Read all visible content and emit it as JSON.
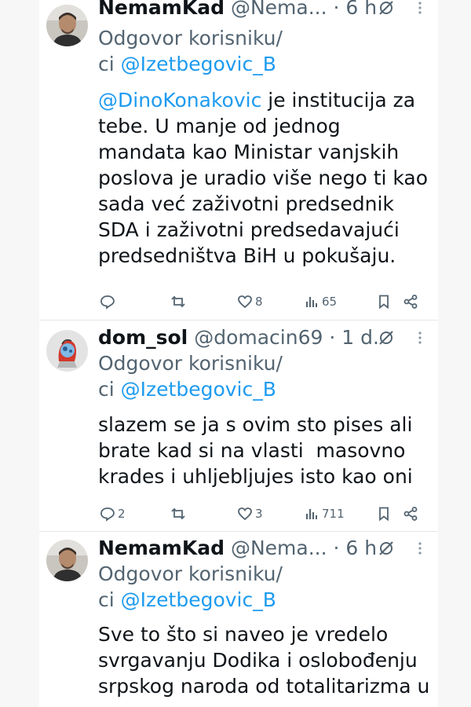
{
  "reply_prefix": "Odgovor korisniku/",
  "reply_ci": "ci",
  "tweets": [
    {
      "name": "NemamKad",
      "handle": "@Nema...",
      "sep": "·",
      "time": "6 h",
      "reply_target": "@Izetbegovic_B",
      "mention": "@DinoKonakovic",
      "text_after_mention": " je institucija za\ntebe. U manje od jednog\nmandata kao Ministar vanjskih\nposlova je uradio više nego ti kao\nsada već zaživotni predsednik\nSDA i zaživotni predsedavajući\npredsedništva BiH u pokušaju.",
      "replies": "",
      "reposts": "",
      "likes": "8",
      "views": "65"
    },
    {
      "name": "dom_sol",
      "handle": "@domacin69",
      "sep": "·",
      "time": "1 d.",
      "reply_target": "@Izetbegovic_B",
      "text": "slazem se ja s ovim sto pises ali\nbrate kad si na vlasti  masovno\nkrades i uhljebljujes isto kao oni",
      "replies": "2",
      "reposts": "",
      "likes": "3",
      "views": "711"
    },
    {
      "name": "NemamKad",
      "handle": "@Nema...",
      "sep": "·",
      "time": "6 h",
      "reply_target": "@Izetbegovic_B",
      "text": "Sve to što si naveo je vredelo\nsvrgavanju Dodika i oslobođenju\nsrpskog naroda od totalitarizma u"
    }
  ],
  "icons": {
    "reply": "reply-icon",
    "repost": "repost-icon",
    "like": "heart-icon",
    "views": "views-icon",
    "bookmark": "bookmark-icon",
    "share": "share-icon",
    "grok": "grok-icon",
    "more": "more-icon"
  },
  "colors": {
    "link": "#1d9bf0",
    "muted": "#536471",
    "text": "#0f1419"
  }
}
